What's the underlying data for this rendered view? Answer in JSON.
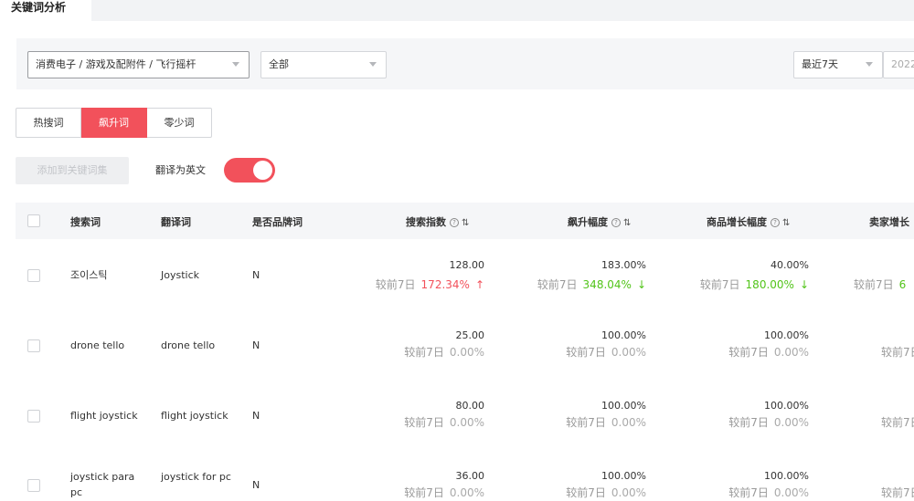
{
  "page_tab": "关键词分析",
  "filters": {
    "category": "消费电子 / 游戏及配附件 / 飞行摇杆",
    "scope": "全部",
    "range": "最近7天",
    "date": "2022"
  },
  "segments": [
    "热搜词",
    "飙升词",
    "零少词"
  ],
  "active_segment": "飙升词",
  "add_button": "添加到关键词集",
  "translate_label": "翻译为英文",
  "translate_on": true,
  "columns": {
    "keyword": "搜索词",
    "translation": "翻译词",
    "brand": "是否品牌词",
    "search_index": "搜索指数",
    "rise": "飙升幅度",
    "goods_growth": "商品增长幅度",
    "seller_growth": "卖家增长"
  },
  "compare_label": "较前7日",
  "rows": [
    {
      "keyword": "조이스틱",
      "translation": "Joystick",
      "brand": "N",
      "search_index": "128.00",
      "search_index_cmp": "172.34%",
      "search_index_dir": "up",
      "rise": "183.00%",
      "rise_cmp": "348.04%",
      "rise_dir": "down",
      "goods": "40.00%",
      "goods_cmp": "180.00%",
      "goods_dir": "down",
      "seller_cmp": "6"
    },
    {
      "keyword": "drone tello",
      "translation": "drone tello",
      "brand": "N",
      "search_index": "25.00",
      "search_index_cmp": "0.00%",
      "search_index_dir": "flat",
      "rise": "100.00%",
      "rise_cmp": "0.00%",
      "rise_dir": "flat",
      "goods": "100.00%",
      "goods_cmp": "0.00%",
      "goods_dir": "flat",
      "seller_cmp": ""
    },
    {
      "keyword": "flight joystick",
      "translation": "flight joystick",
      "brand": "N",
      "search_index": "80.00",
      "search_index_cmp": "0.00%",
      "search_index_dir": "flat",
      "rise": "100.00%",
      "rise_cmp": "0.00%",
      "rise_dir": "flat",
      "goods": "100.00%",
      "goods_cmp": "0.00%",
      "goods_dir": "flat",
      "seller_cmp": ""
    },
    {
      "keyword": "joystick para pc",
      "translation": "joystick for pc",
      "brand": "N",
      "search_index": "36.00",
      "search_index_cmp": "0.00%",
      "search_index_dir": "flat",
      "rise": "100.00%",
      "rise_cmp": "0.00%",
      "rise_dir": "flat",
      "goods": "100.00%",
      "goods_cmp": "0.00%",
      "goods_dir": "flat",
      "seller_cmp": ""
    }
  ],
  "colors": {
    "accent": "#f2515b",
    "up": "#f2515b",
    "down": "#52c41a"
  }
}
